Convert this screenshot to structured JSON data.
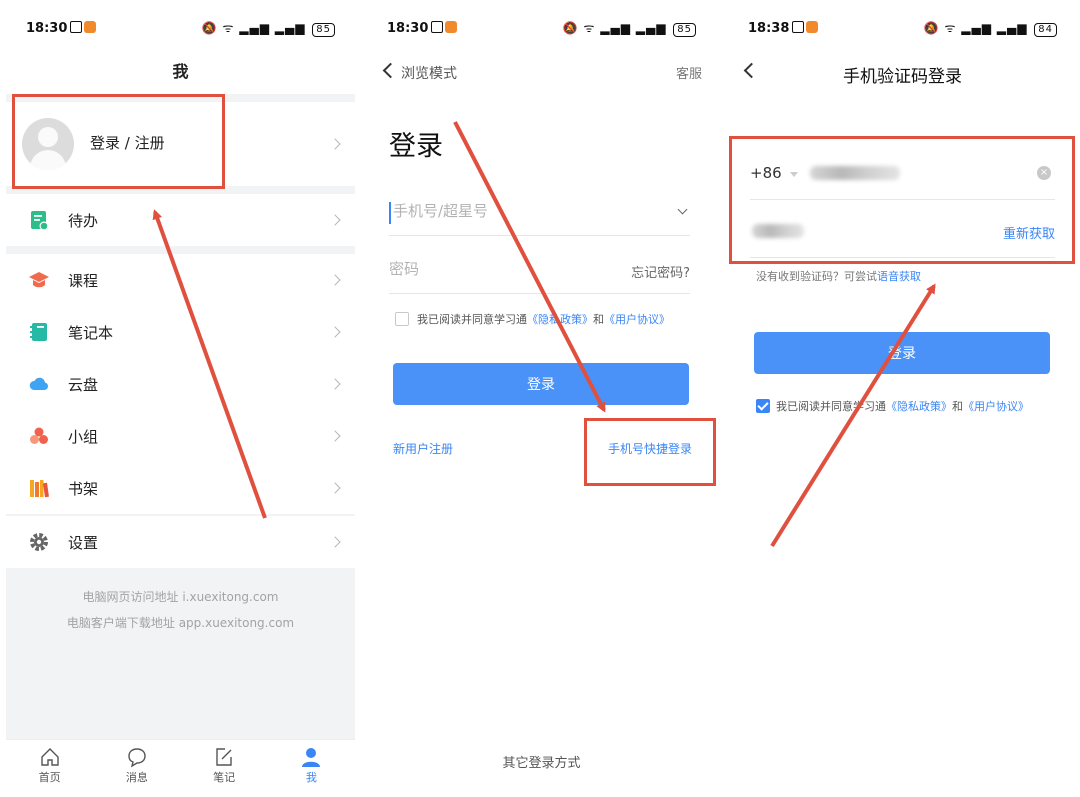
{
  "panel1": {
    "status": {
      "time": "18:30",
      "battery": "85"
    },
    "title": "我",
    "login_label": "登录 / 注册",
    "menu": [
      {
        "label": "待办",
        "icon": "todo-icon"
      },
      {
        "label": "课程",
        "icon": "graduation-cap-icon"
      },
      {
        "label": "笔记本",
        "icon": "notebook-icon"
      },
      {
        "label": "云盘",
        "icon": "cloud-icon"
      },
      {
        "label": "小组",
        "icon": "group-icon"
      },
      {
        "label": "书架",
        "icon": "bookshelf-icon"
      },
      {
        "label": "设置",
        "icon": "gear-icon"
      }
    ],
    "footer_line1": "电脑网页访问地址 i.xuexitong.com",
    "footer_line2": "电脑客户端下载地址 app.xuexitong.com",
    "tabs": [
      {
        "label": "首页",
        "icon": "home-icon"
      },
      {
        "label": "消息",
        "icon": "message-icon"
      },
      {
        "label": "笔记",
        "icon": "note-edit-icon"
      },
      {
        "label": "我",
        "icon": "profile-icon",
        "active": true
      }
    ]
  },
  "panel2": {
    "status": {
      "time": "18:30",
      "battery": "85"
    },
    "back_label": "浏览模式",
    "service_label": "客服",
    "heading": "登录",
    "phone_placeholder": "手机号/超星号",
    "password_placeholder": "密码",
    "forgot_label": "忘记密码?",
    "agree_prefix": "我已阅读并同意学习通",
    "privacy_link": "《隐私政策》",
    "and_text": "和",
    "terms_link": "《用户协议》",
    "login_button": "登录",
    "register_link": "新用户注册",
    "quick_login_link": "手机号快捷登录",
    "other_login": "其它登录方式"
  },
  "panel3": {
    "status": {
      "time": "18:38",
      "battery": "84"
    },
    "title": "手机验证码登录",
    "country_code": "+86",
    "resend_label": "重新获取",
    "hint_prefix": "没有收到验证码？可尝试",
    "hint_link": "语音获取",
    "login_button": "登录",
    "agree_prefix": "我已阅读并同意学习通",
    "privacy_link": "《隐私政策》",
    "and_text": "和",
    "terms_link": "《用户协议》"
  },
  "colors": {
    "accent": "#3a86f6",
    "button": "#4a92f7",
    "annotation": "#e0503f"
  }
}
